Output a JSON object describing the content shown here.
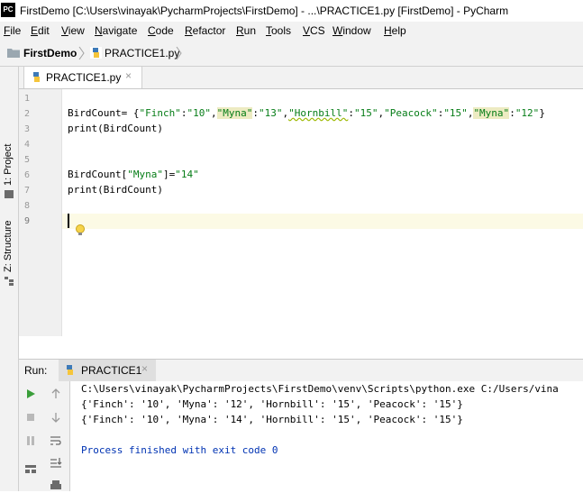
{
  "window": {
    "title": "FirstDemo [C:\\Users\\vinayak\\PycharmProjects\\FirstDemo] - ...\\PRACTICE1.py [FirstDemo] - PyCharm",
    "logo_text": "PC"
  },
  "menu": [
    {
      "mnemonic": "F",
      "rest": "ile"
    },
    {
      "mnemonic": "E",
      "rest": "dit"
    },
    {
      "mnemonic": "V",
      "rest": "iew"
    },
    {
      "mnemonic": "N",
      "rest": "avigate"
    },
    {
      "mnemonic": "C",
      "rest": "ode"
    },
    {
      "mnemonic": "R",
      "rest": "efactor"
    },
    {
      "mnemonic": "R",
      "rest": "un"
    },
    {
      "mnemonic": "T",
      "rest": "ools"
    },
    {
      "mnemonic": "V",
      "rest": "CS"
    },
    {
      "mnemonic": "W",
      "rest": "indow"
    },
    {
      "mnemonic": "H",
      "rest": "elp"
    }
  ],
  "breadcrumb": {
    "project": "FirstDemo",
    "file": "PRACTICE1.py"
  },
  "side_tabs": {
    "project": "1: Project",
    "structure": "Z: Structure"
  },
  "editor": {
    "tab_label": "PRACTICE1.py",
    "line_numbers": [
      "1",
      "2",
      "3",
      "4",
      "5",
      "6",
      "7",
      "8",
      "9"
    ],
    "lines": {
      "l2_a": "BirdCount= {",
      "l2_k1": "\"Finch\"",
      "l2_c1": ":",
      "l2_v1": "\"10\"",
      "l2_s1": ",",
      "l2_k2": "\"Myna\"",
      "l2_c2": ":",
      "l2_v2": "\"13\"",
      "l2_s2": ",",
      "l2_k3": "\"Hornbill\"",
      "l2_c3": ":",
      "l2_v3": "\"15\"",
      "l2_s3": ",",
      "l2_k4": "\"Peacock\"",
      "l2_c4": ":",
      "l2_v4": "\"15\"",
      "l2_s4": ",",
      "l2_k5": "\"Myna\"",
      "l2_c5": ":",
      "l2_v5": "\"12\"",
      "l2_end": "}",
      "l3": "print(BirdCount)",
      "l6_a": "BirdCount[",
      "l6_k": "\"Myna\"",
      "l6_b": "]=",
      "l6_v": "\"14\"",
      "l7": "print(BirdCount)"
    },
    "current_line": 9
  },
  "run": {
    "label": "Run:",
    "tab_label": "PRACTICE1",
    "output": [
      "C:\\Users\\vinayak\\PycharmProjects\\FirstDemo\\venv\\Scripts\\python.exe C:/Users/vina",
      "{'Finch': '10', 'Myna': '12', 'Hornbill': '15', 'Peacock': '15'}",
      "{'Finch': '10', 'Myna': '14', 'Hornbill': '15', 'Peacock': '15'}",
      "Process finished with exit code 0"
    ]
  },
  "colors": {
    "string": "#067d17",
    "keyword_blue": "#0033b3",
    "run_green": "#3a9e3a",
    "highlight": "#edebc2"
  }
}
